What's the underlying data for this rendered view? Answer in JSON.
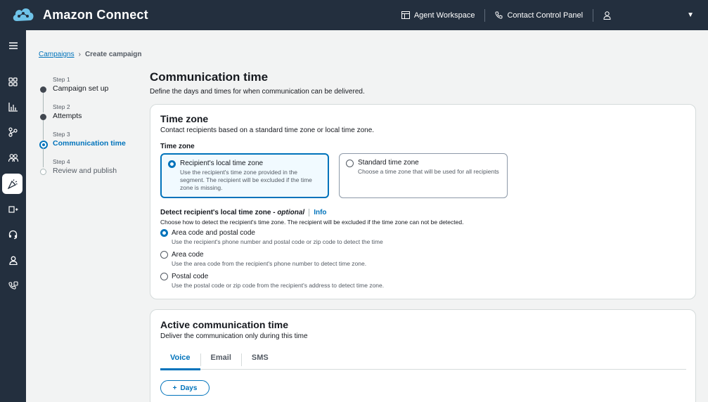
{
  "app": {
    "title": "Amazon Connect"
  },
  "topbar": {
    "agent_workspace": "Agent Workspace",
    "contact_control_panel": "Contact Control Panel"
  },
  "breadcrumb": {
    "parent": "Campaigns",
    "current": "Create campaign"
  },
  "steps": [
    {
      "num": "Step 1",
      "label": "Campaign set up",
      "state": "done"
    },
    {
      "num": "Step 2",
      "label": "Attempts",
      "state": "done"
    },
    {
      "num": "Step 3",
      "label": "Communication time",
      "state": "current"
    },
    {
      "num": "Step 4",
      "label": "Review and publish",
      "state": "pending"
    }
  ],
  "page": {
    "title": "Communication time",
    "description": "Define the days and times for when communication can be delivered."
  },
  "timezone_card": {
    "title": "Time zone",
    "description": "Contact recipients based on a standard time zone or local time zone.",
    "field_label": "Time zone",
    "tiles": [
      {
        "title": "Recipient's local time zone",
        "desc": "Use the recipient's time zone provided in the segment. The recipient will be excluded if the time zone is missing.",
        "selected": true
      },
      {
        "title": "Standard time zone",
        "desc": "Choose a time zone that will be used for all recipients",
        "selected": false
      }
    ],
    "detect_label": "Detect recipient's local time zone - ",
    "detect_optional": "optional",
    "info_label": "Info",
    "detect_desc": "Choose how to detect the recipient's time zone. The recipient will be excluded if the time zone can not be detected.",
    "options": [
      {
        "title": "Area code and postal code",
        "desc": "Use the recipient's phone number and postal code or zip code to detect the time",
        "selected": true
      },
      {
        "title": "Area code",
        "desc": "Use the area code from the recipient's phone number to detect time zone.",
        "selected": false
      },
      {
        "title": "Postal code",
        "desc": "Use the postal code or zip code from the recipient's address to detect time zone.",
        "selected": false
      }
    ]
  },
  "active_card": {
    "title": "Active communication time",
    "description": "Deliver the communication only during this time",
    "tabs": [
      "Voice",
      "Email",
      "SMS"
    ],
    "active_tab": "Voice",
    "add_days_label": "Days"
  },
  "colors": {
    "nav": "#232f3e",
    "accent": "#0073bb"
  }
}
